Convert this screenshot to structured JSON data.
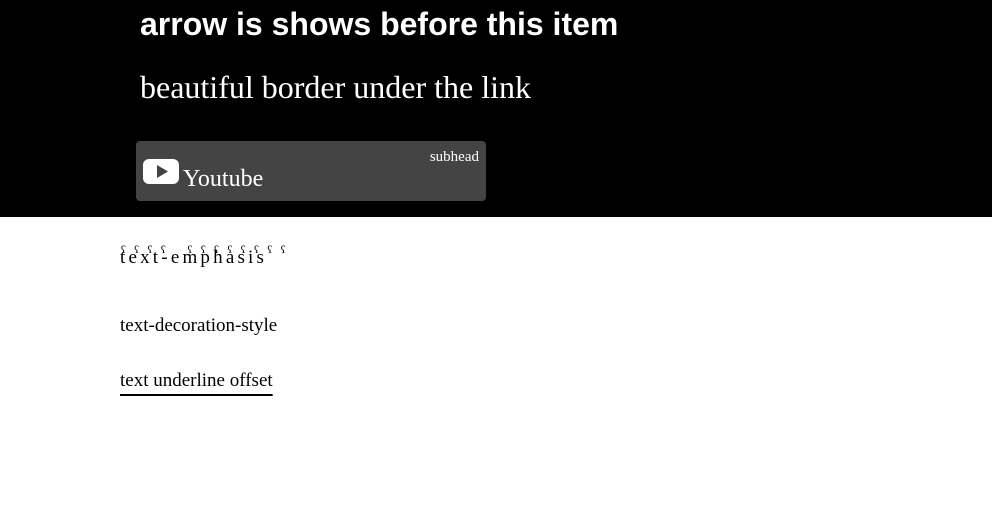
{
  "hero": {
    "background_color": "#000000",
    "heading": "arrow is shows before this item",
    "link_text": "beautiful border under the link",
    "card": {
      "background_color": "#444444",
      "icon": "youtube-play-icon",
      "title": "Youtube",
      "subhead": "subhead"
    }
  },
  "examples": {
    "text_emphasis": "text-emphasis",
    "text_emphasis_mark": "ʕ",
    "text_decoration_style": "text-decoration-style",
    "text_underline_offset": "text underline offset"
  }
}
